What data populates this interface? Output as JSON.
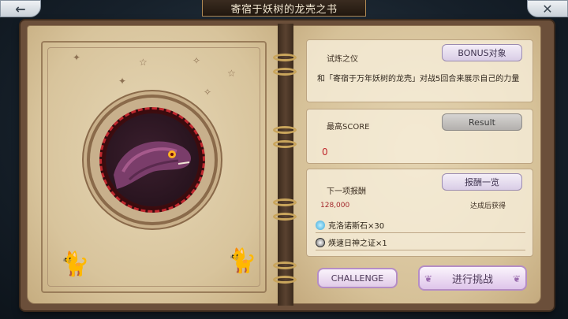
{
  "header": {
    "title": "寄宿于妖树的龙壳之书",
    "back_icon": "back-arrow-icon",
    "close_icon": "close-icon"
  },
  "trial": {
    "label": "试炼之仪",
    "bonus_button": "BONUS对象",
    "description": "和「寄宿于万年妖树的龙壳」对战5回合来展示自己的力量"
  },
  "score": {
    "label": "最高SCORE",
    "result_button": "Result",
    "value": "0"
  },
  "reward": {
    "label": "下一项报酬",
    "list_button": "报酬一览",
    "threshold": "128,000",
    "obtain_text": "达成后获得",
    "items": [
      {
        "icon": "crystal-icon",
        "text": "克洛诺斯石×30"
      },
      {
        "icon": "medal-icon",
        "text": "煐速日神之证×1"
      }
    ]
  },
  "actions": {
    "challenge": "CHALLENGE",
    "start": "进行挑战"
  },
  "colors": {
    "score_red": "#c0282e",
    "lavender": "#d9cde6",
    "parchment": "#e4d4b2"
  }
}
